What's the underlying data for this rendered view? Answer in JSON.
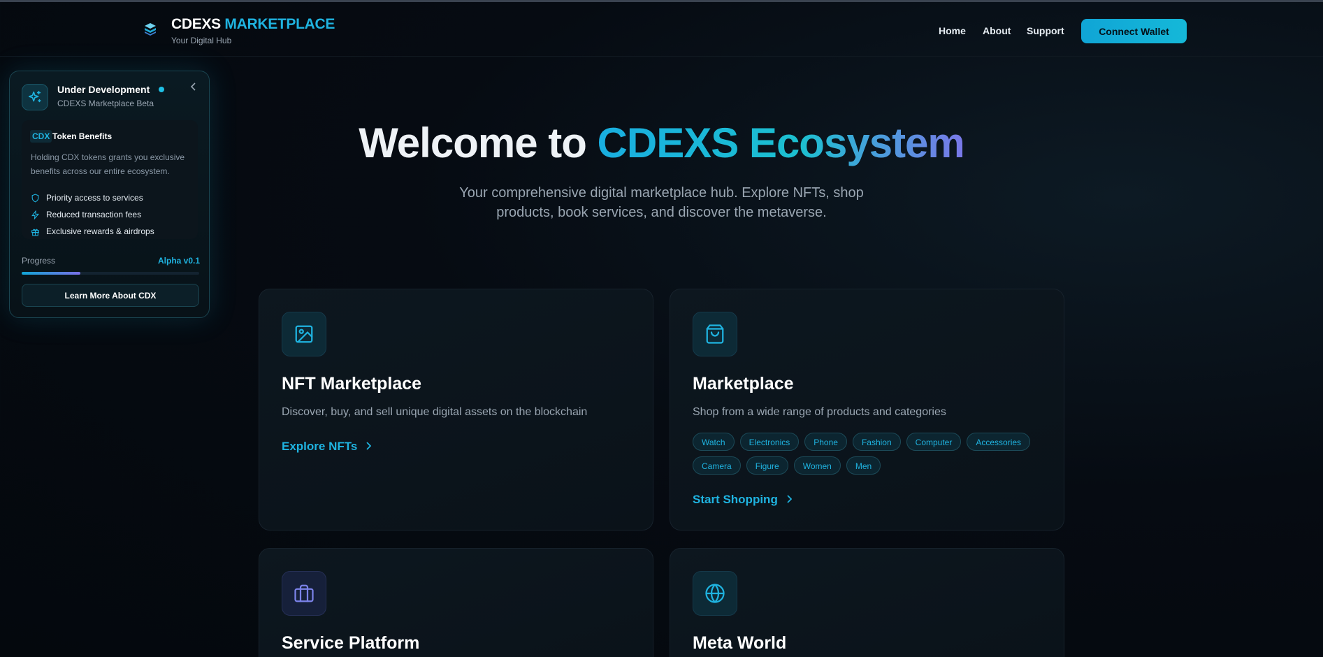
{
  "header": {
    "brand_part1": "CDEXS",
    "brand_part2": "MARKETPLACE",
    "tagline": "Your Digital Hub",
    "nav": [
      "Home",
      "About",
      "Support"
    ],
    "connect_label": "Connect Wallet"
  },
  "dev_panel": {
    "title": "Under Development",
    "subtitle": "CDEXS Marketplace Beta",
    "token_badge": "CDX",
    "token_title": "Token Benefits",
    "token_desc": "Holding CDX tokens grants you exclusive benefits across our entire ecosystem.",
    "benefits": [
      {
        "icon": "shield-icon",
        "label": "Priority access to services"
      },
      {
        "icon": "lightning-icon",
        "label": "Reduced transaction fees"
      },
      {
        "icon": "gift-icon",
        "label": "Exclusive rewards & airdrops"
      }
    ],
    "progress_label": "Progress",
    "progress_version": "Alpha v0.1",
    "progress_percent": 33,
    "learn_label": "Learn More About CDX"
  },
  "hero": {
    "title_white": "Welcome to",
    "title_gradient": "CDEXS Ecosystem",
    "subtitle": "Your comprehensive digital marketplace hub. Explore NFTs, shop products, book services, and discover the metaverse."
  },
  "cards": {
    "nft": {
      "icon": "image-icon",
      "title": "NFT Marketplace",
      "desc": "Discover, buy, and sell unique digital assets on the blockchain",
      "link": "Explore NFTs"
    },
    "market": {
      "icon": "shopping-bag-icon",
      "title": "Marketplace",
      "desc": "Shop from a wide range of products and categories",
      "tags": [
        "Watch",
        "Electronics",
        "Phone",
        "Fashion",
        "Computer",
        "Accessories",
        "Camera",
        "Figure",
        "Women",
        "Men"
      ],
      "link": "Start Shopping"
    },
    "service": {
      "icon": "briefcase-icon",
      "title": "Service Platform"
    },
    "meta": {
      "icon": "globe-icon",
      "title": "Meta World"
    }
  },
  "colors": {
    "accent": "#1fb3e0",
    "background": "#060b12",
    "gradient_end": "#7a78e8"
  }
}
